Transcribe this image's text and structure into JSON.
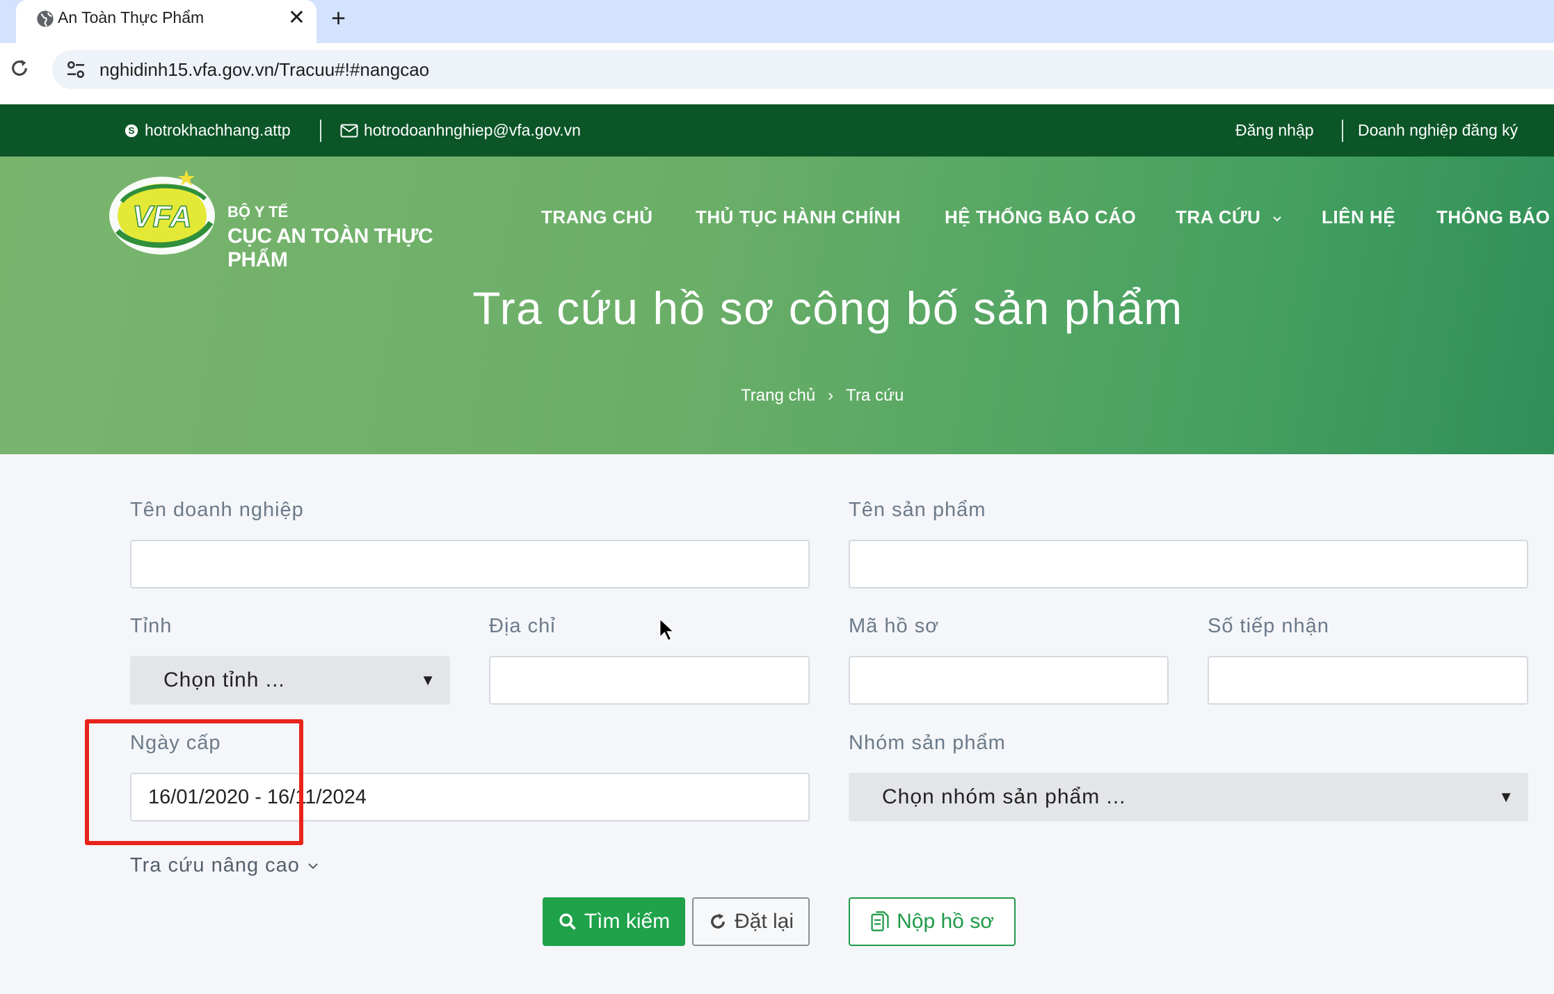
{
  "browser": {
    "tab_title": "An Toàn Thực Phẩm",
    "url": "nghidinh15.vfa.gov.vn/Tracuu#!#nangcao",
    "new_tab_symbol": "+",
    "close_symbol": "✕"
  },
  "topbar": {
    "skype": "hotrokhachhang.attp",
    "email": "hotrodoanhnghiep@vfa.gov.vn",
    "login": "Đăng nhập",
    "register": "Doanh nghiệp đăng ký"
  },
  "logo": {
    "mark": "VFA",
    "line1": "BỘ Y TẾ",
    "line2": "CỤC AN TOÀN THỰC PHẨM"
  },
  "nav": {
    "home": "TRANG CHỦ",
    "procedures": "THỦ TỤC HÀNH CHÍNH",
    "reports": "HỆ THỐNG BÁO CÁO",
    "lookup": "TRA CỨU",
    "contact": "LIÊN HỆ",
    "notices": "THÔNG BÁO"
  },
  "hero": {
    "title": "Tra cứu hồ sơ công bố sản phẩm",
    "breadcrumb_home": "Trang chủ",
    "breadcrumb_sep": "›",
    "breadcrumb_current": "Tra cứu"
  },
  "form": {
    "company_label": "Tên doanh nghiệp",
    "company_value": "",
    "product_label": "Tên sản phẩm",
    "product_value": "",
    "province_label": "Tỉnh",
    "province_selected": "Chọn tỉnh ...",
    "address_label": "Địa chỉ",
    "address_value": "",
    "file_code_label": "Mã hồ sơ",
    "file_code_value": "",
    "receipt_label": "Số tiếp nhận",
    "receipt_value": "",
    "date_label": "Ngày cấp",
    "date_value": "16/01/2020 - 16/11/2024",
    "group_label": "Nhóm sản phẩm",
    "group_selected": "Chọn nhóm sản phẩm ...",
    "advanced": "Tra cứu nâng cao"
  },
  "buttons": {
    "search": "Tìm kiếm",
    "reset": "Đặt lại",
    "submit": "Nộp hồ sơ"
  },
  "colors": {
    "topbar": "#0b5527",
    "primary_green": "#1fa24a",
    "highlight_red": "#e8241b"
  }
}
